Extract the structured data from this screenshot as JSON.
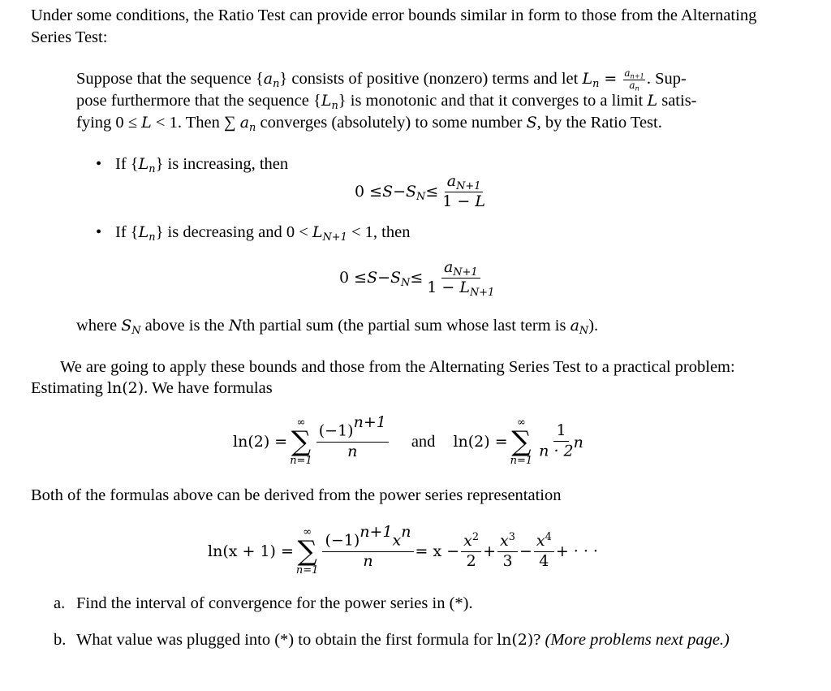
{
  "intro": {
    "line1": "Under some conditions, the Ratio Test can provide error bounds similar in form to those from the Alternating",
    "line2": "Series Test:"
  },
  "theorem": {
    "l1_a": "Suppose that the sequence {",
    "l1_an": "a",
    "l1_an_sub": "n",
    "l1_b": "} consists of positive (nonzero) terms and let ",
    "l1_L": "L",
    "l1_L_sub": "n",
    "l1_eq": " = ",
    "l1_frac_num": "a",
    "l1_frac_num_sub": "n+1",
    "l1_frac_den": "a",
    "l1_frac_den_sub": "n",
    "l1_c": ". Sup-",
    "l2_a": "pose furthermore that the sequence {",
    "l2_L": "L",
    "l2_L_sub": "n",
    "l2_b": "} is monotonic and that it converges to a limit ",
    "l2_L2": "L",
    "l2_c": " satis-",
    "l3_a": "fying 0 ≤ ",
    "l3_L": "L",
    "l3_b": " < 1. Then ∑ ",
    "l3_an": "a",
    "l3_an_sub": "n",
    "l3_c": " converges (absolutely) to some number ",
    "l3_S": "S",
    "l3_d": ", by the Ratio Test."
  },
  "bullets": [
    {
      "pre": "If {",
      "L": "L",
      "L_sub": "n",
      "post": "} is increasing, then",
      "formula": {
        "lhs": "0 ≤ ",
        "S": "S",
        "minus": " − ",
        "SN": "S",
        "SN_sub": "N",
        "le": " ≤ ",
        "num": "a",
        "num_sub": "N+1",
        "den_a": "1 − ",
        "den_L": "L",
        "den_sub": ""
      }
    },
    {
      "pre": "If {",
      "L": "L",
      "L_sub": "n",
      "mid": "} is decreasing and 0 < ",
      "L2": "L",
      "L2_sub": "N+1",
      "post": " < 1, then",
      "formula": {
        "lhs": "0 ≤ ",
        "S": "S",
        "minus": " − ",
        "SN": "S",
        "SN_sub": "N",
        "le": " ≤ ",
        "num": "a",
        "num_sub": "N+1",
        "den_a": "1 − ",
        "den_L": "L",
        "den_sub": "N+1"
      }
    }
  ],
  "where_line": {
    "a": "where ",
    "S": "S",
    "S_sub": "N",
    "b": " above is the ",
    "N": "N",
    "c": "th partial sum (the partial sum whose last term is ",
    "aN": "a",
    "aN_sub": "N",
    "d": ")."
  },
  "apply": {
    "line1": "We are going to apply these bounds and those from the Alternating Series Test to a practical problem:",
    "line2_a": "Estimating ",
    "line2_ln": "ln(2)",
    "line2_b": ". We have formulas"
  },
  "formulas": {
    "f1_lhs": "ln(2) = ",
    "sum_top": "∞",
    "sum_sym": "∑",
    "sum_bottom": "n=1",
    "f1_num": "(−1)",
    "f1_num_sup": "n+1",
    "f1_den": "n",
    "and": "and",
    "f2_lhs": "ln(2) = ",
    "f2_num": "1",
    "f2_den": "n · 2",
    "f2_den_sup": "n"
  },
  "both_line": "Both of the formulas above can be derived from the power series representation",
  "power_series": {
    "lhs": "ln(x + 1) = ",
    "num": "(−1)",
    "num_sup": "n+1",
    "num_x": "x",
    "num_x_sup": "n",
    "den": "n",
    "eq_x": " = x − ",
    "t2_num": "x",
    "t2_sup": "2",
    "t2_den": "2",
    "plus1": " + ",
    "t3_num": "x",
    "t3_sup": "3",
    "t3_den": "3",
    "minus2": " − ",
    "t4_num": "x",
    "t4_sup": "4",
    "t4_den": "4",
    "tail": " + · · ·"
  },
  "questions": [
    {
      "label": "a.",
      "text": "Find the interval of convergence for the power series in (*)."
    },
    {
      "label": "b.",
      "text_a": "What value was plugged into (*) to obtain the first formula for ",
      "ln": "ln(2)",
      "text_b": "? ",
      "note": "(More problems next page.)"
    }
  ]
}
